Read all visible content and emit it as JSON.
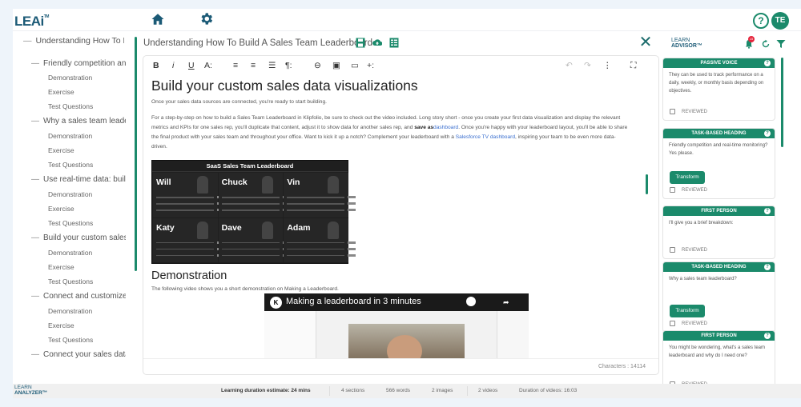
{
  "header": {
    "logo": "LEAi",
    "logo_tm": "TM",
    "help_label": "?",
    "avatar_initials": "TE"
  },
  "outline": [
    {
      "level": 0,
      "label": "Understanding How To Build A Sales Team Leaderboard"
    },
    {
      "level": 1,
      "label": "Friendly competition and real-time monitoring"
    },
    {
      "level": 2,
      "label": "Demonstration"
    },
    {
      "level": 2,
      "label": "Exercise"
    },
    {
      "level": 2,
      "label": "Test Questions"
    },
    {
      "level": 1,
      "label": "Why a sales team leaderboard"
    },
    {
      "level": 2,
      "label": "Demonstration"
    },
    {
      "level": 2,
      "label": "Exercise"
    },
    {
      "level": 2,
      "label": "Test Questions"
    },
    {
      "level": 1,
      "label": "Use real-time data: build"
    },
    {
      "level": 2,
      "label": "Demonstration"
    },
    {
      "level": 2,
      "label": "Exercise"
    },
    {
      "level": 2,
      "label": "Test Questions"
    },
    {
      "level": 1,
      "label": "Build your custom sales data visualizations"
    },
    {
      "level": 2,
      "label": "Demonstration"
    },
    {
      "level": 2,
      "label": "Exercise"
    },
    {
      "level": 2,
      "label": "Test Questions"
    },
    {
      "level": 1,
      "label": "Connect and customize"
    },
    {
      "level": 2,
      "label": "Demonstration"
    },
    {
      "level": 2,
      "label": "Exercise"
    },
    {
      "level": 2,
      "label": "Test Questions"
    },
    {
      "level": 1,
      "label": "Connect your sales data"
    }
  ],
  "document": {
    "title": "Understanding How To Build A Sales Team Leaderboard",
    "close_label": "✕"
  },
  "toolbar": {
    "bold": "B",
    "italic": "i",
    "underline": "U",
    "font_size": "A:",
    "align": "≡",
    "center": "≡",
    "list": "☰",
    "paragraph": "¶:",
    "link": "⊖",
    "image": "▣",
    "video": "▭",
    "insert": "+:",
    "undo": "↶",
    "redo": "↷",
    "more": "⋮",
    "fullscreen": "⛶"
  },
  "content": {
    "heading": "Build your custom sales data visualizations",
    "intro": "Once your sales data sources are connected, you're ready to start building.",
    "para_a": "For a step-by-step on how to build a Sales Team Leaderboard in Klipfolio, be sure to check out the video included. Long story short - once you create your first data visualization and display the relevant metrics and KPIs for one sales rep, you'll duplicate that content, adjust it to show data for another sales rep, and ",
    "para_bold": "save as",
    "para_link1": "dashboard",
    "para_b": ". Once you're happy with your leaderboard layout, you'll be able to share the final product with your sales team and throughout your office. Want to kick it up a notch? Complement your leaderboard with a ",
    "para_link2": "Salesforce TV dashboard",
    "para_c": ", inspiring your team to be even more data-driven.",
    "image": {
      "title": "SaaS Sales Team Leaderboard",
      "people": [
        "Will",
        "Chuck",
        "Vin",
        "Katy",
        "Dave",
        "Adam"
      ]
    },
    "demo_heading": "Demonstration",
    "demo_text": "The following video shows you a short demonstration on Making a Leaderboard.",
    "video": {
      "title": "Making a leaderboard in 3 minutes",
      "channel_initial": "K"
    },
    "characters_label": "Characters : 14114"
  },
  "advisor": {
    "title_line1": "LEARN",
    "title_line2": "ADVISOR™",
    "notification_count": "15",
    "cards": [
      {
        "type": "PASSIVE VOICE",
        "text": "They can be used to track performance on a daily, weekly, or monthly basis depending on objectives.",
        "has_transform": false,
        "reviewed_label": "REVIEWED"
      },
      {
        "type": "TASK-BASED HEADING",
        "text": "Friendly competition and real-time monitoring? Yes please.",
        "has_transform": true,
        "reviewed_label": "REVIEWED"
      },
      {
        "type": "FIRST PERSON",
        "text": "I'll give you a brief breakdown:",
        "has_transform": false,
        "reviewed_label": "REVIEWED"
      },
      {
        "type": "TASK-BASED HEADING",
        "text": "Why a sales team leaderboard?",
        "has_transform": true,
        "reviewed_label": "REVIEWED"
      },
      {
        "type": "FIRST PERSON",
        "text": "You might be wondering, what's a sales team leaderboard and why do I need one?",
        "has_transform": false,
        "reviewed_label": "REVIEWED"
      }
    ],
    "transform_label": "Transform",
    "help_label": "?"
  },
  "footer": {
    "logo_line1": "LEARN",
    "logo_line2": "ANALYZER™",
    "duration": "Learning duration estimate: 24 mins",
    "sections": "4 sections",
    "words": "566 words",
    "images": "2 images",
    "videos": "2 videos",
    "video_duration": "Duration of videos: 16:03"
  },
  "colors": {
    "accent": "#1b8a6b",
    "brand_dark": "#1b5a76",
    "link": "#3a6fcf",
    "badge": "#e5243b"
  }
}
